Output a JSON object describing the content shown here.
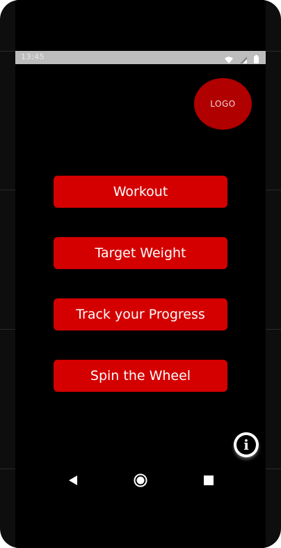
{
  "status_bar": {
    "time": "13:45",
    "icons": [
      "wifi-icon",
      "signal-icon",
      "battery-icon"
    ]
  },
  "logo": {
    "label": "LOGO"
  },
  "menu": {
    "buttons": [
      {
        "label": "Workout"
      },
      {
        "label": "Target Weight"
      },
      {
        "label": "Track your Progress"
      },
      {
        "label": "Spin the Wheel"
      }
    ]
  },
  "info_button": {
    "glyph": "i"
  },
  "nav": {
    "items": [
      "back-icon",
      "home-icon",
      "recents-icon"
    ]
  },
  "colors": {
    "accent": "#d40000",
    "logo_bg": "#b10000",
    "background": "#000000",
    "status_bar": "#bdbdbd"
  }
}
